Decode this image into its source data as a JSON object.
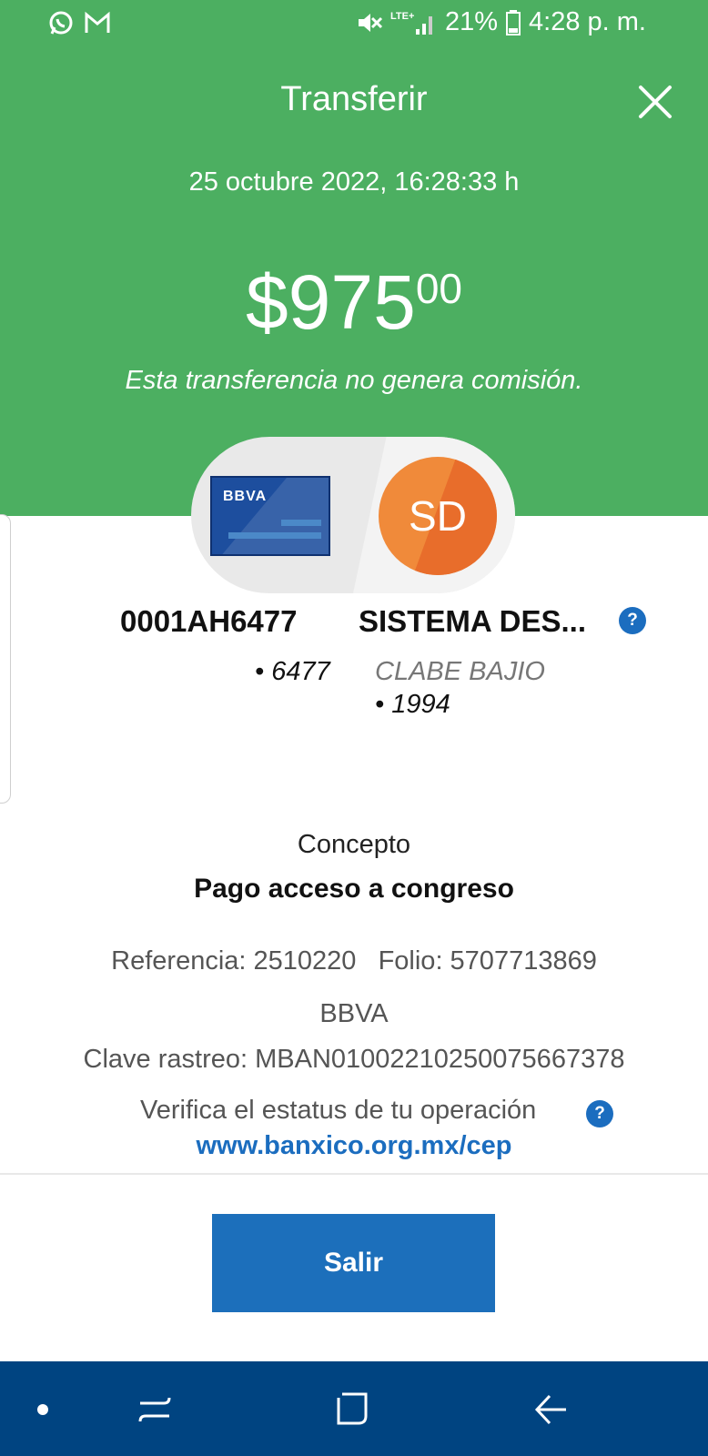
{
  "status_bar": {
    "battery": "21%",
    "time": "4:28 p. m.",
    "network": "LTE+",
    "icons": [
      "whatsapp-icon",
      "gmail-icon",
      "mute-icon",
      "signal-icon",
      "battery-icon"
    ]
  },
  "header": {
    "title": "Transferir",
    "date": "25 octubre 2022, 16:28:33 h",
    "amount_main": "$975",
    "amount_cents": "00",
    "commission_note": "Esta transferencia no genera comisión."
  },
  "origin": {
    "card_brand": "BBVA",
    "account": "0001AH6477",
    "last_digits": "• 6477"
  },
  "destination": {
    "initials": "SD",
    "name": "SISTEMA DES...",
    "bank": "CLABE BAJIO",
    "last_digits": "• 1994"
  },
  "details": {
    "concept_label": "Concepto",
    "concept_value": "Pago acceso a congreso",
    "reference_line": "Referencia: 2510220   Folio: 5707713869",
    "bank": "BBVA",
    "tracking": "Clave rastreo: MBAN01002210250075667378",
    "verify_text": "Verifica el estatus de tu operación",
    "verify_link": "www.banxico.org.mx/cep",
    "help_glyph": "?"
  },
  "actions": {
    "exit_label": "Salir"
  },
  "colors": {
    "header_green": "#4caf61",
    "accent_blue": "#1c6fbb",
    "nav_blue": "#004481",
    "avatar_orange": "#f08a3a"
  }
}
